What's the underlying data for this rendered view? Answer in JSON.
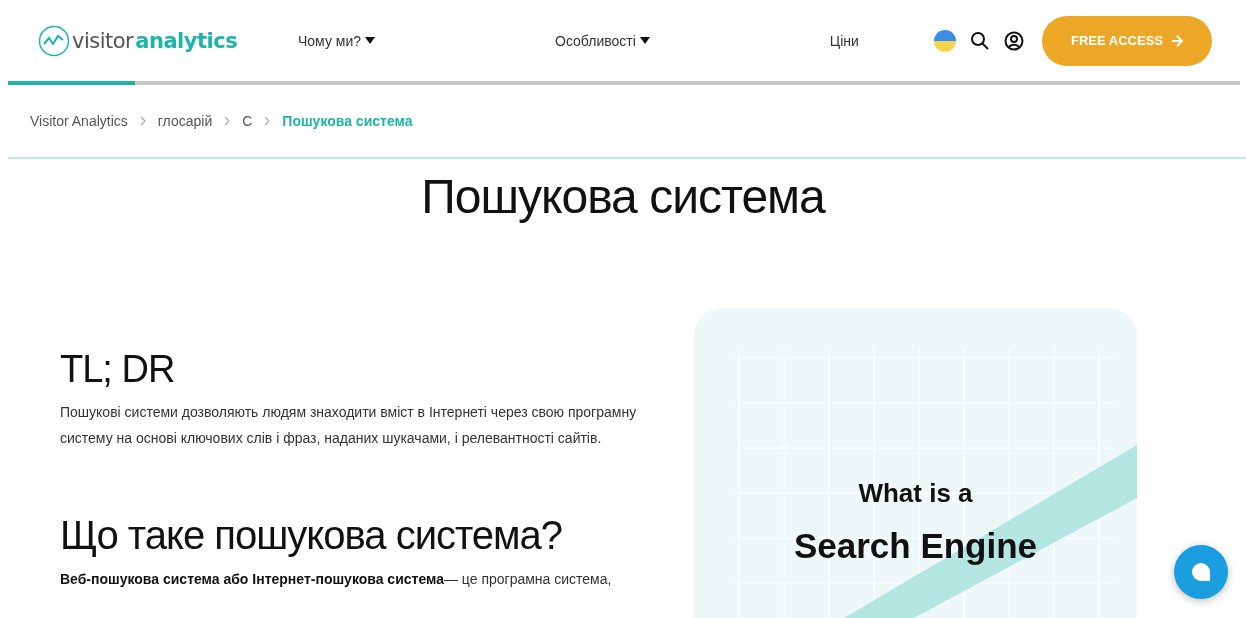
{
  "header": {
    "logo": {
      "part_1": "visitor",
      "part_2": "analytics"
    },
    "nav": [
      {
        "label": "Чому ми?",
        "dropdown": true
      },
      {
        "label": "Особливості",
        "dropdown": true
      },
      {
        "label": "Ціни",
        "dropdown": false
      }
    ],
    "cta": "FREE ACCESS"
  },
  "reading_progress": {
    "level": 0.103
  },
  "breadcrumb": [
    {
      "label": "Visitor Analytics",
      "current": false
    },
    {
      "label": "глосарій",
      "current": false
    },
    {
      "label": "C",
      "current": false
    },
    {
      "label": "Пошукова система",
      "current": true
    }
  ],
  "page_title": "Пошукова система",
  "sections": [
    {
      "heading": "TL; DR",
      "text": "Пошукові системи дозволяють людям знаходити вміст в Інтернеті через свою програмну систему на основі ключових слів і фраз, наданих шукачами, і релевантності сайтів."
    },
    {
      "heading": "Що таке пошукова система?",
      "text": "**Веб-пошукова система або Інтернет-пошукова система**— це програмна система,"
    }
  ],
  "illustration": {
    "line_1": "What is a",
    "line_2": "Search Engine"
  }
}
